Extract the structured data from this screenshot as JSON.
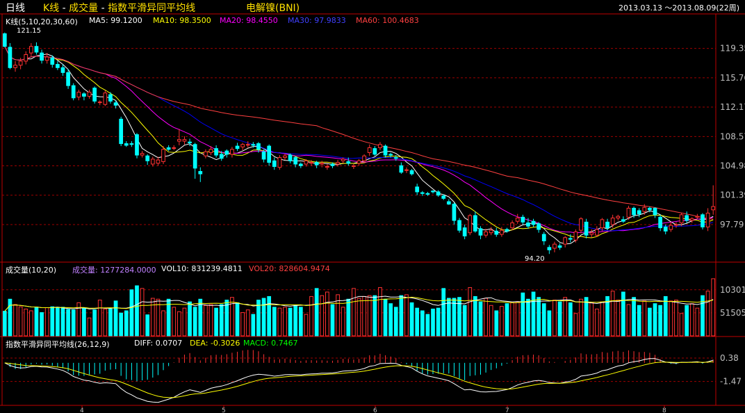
{
  "title_bar": {
    "period": "日线",
    "chart_type": "K线",
    "indicator_vol": "成交量",
    "indicator_macd": "指数平滑异同平均线",
    "separator": " - ",
    "instrument": "电解镍(BNI)",
    "date_range": "2013.03.13 ～2013.08.09(22周)"
  },
  "colors": {
    "up": "#ff3232",
    "down": "#00ffff",
    "ma5": "#ffffff",
    "ma10": "#ffff00",
    "ma20": "#ff00ff",
    "ma30": "#0000ff",
    "ma60": "#ff4040",
    "grid": "#a00000",
    "border": "#c00000",
    "label": "#c0c0c0"
  },
  "price_panel": {
    "header": "K线(5,10,20,30,60)",
    "ma_labels": [
      {
        "text": "MA5: 99.1200",
        "color": "#ffffff"
      },
      {
        "text": "MA10: 98.3500",
        "color": "#ffff00"
      },
      {
        "text": "MA20: 98.4550",
        "color": "#ff00ff"
      },
      {
        "text": "MA30: 97.9833",
        "color": "#4040ff"
      },
      {
        "text": "MA60: 100.4683",
        "color": "#ff4040"
      }
    ],
    "y_ticks": [
      "119.35",
      "115.76",
      "112.17",
      "108.57",
      "104.98",
      "101.39",
      "97.79"
    ],
    "high_label": "121.15",
    "low_label": "94.20"
  },
  "volume_panel": {
    "header": "成交量(10,20)",
    "vol_labels": [
      {
        "text": "成交量: 1277284.0000",
        "color": "#c080ff"
      },
      {
        "text": "VOL10: 831239.4811",
        "color": "#ffffff"
      },
      {
        "text": "VOL20: 828604.9474",
        "color": "#ff4040"
      }
    ],
    "y_ticks": [
      "10301",
      "51505"
    ]
  },
  "macd_panel": {
    "header": "指数平滑异同平均线(26,12,9)",
    "labels": [
      {
        "text": "DIFF: 0.0707",
        "color": "#ffffff"
      },
      {
        "text": "DEA: -0.3026",
        "color": "#ffff00"
      },
      {
        "text": "MACD: 0.7467",
        "color": "#00ff00"
      }
    ],
    "y_ticks": [
      "0.38",
      "-1.47"
    ]
  },
  "x_axis": {
    "month_labels": [
      "4",
      "5",
      "6",
      "7",
      "8"
    ]
  },
  "chart_data": {
    "type": "candlestick",
    "title": "K线 - 成交量 - 指数平滑异同平均线 电解镍(BNI)",
    "period": "daily",
    "date_range": [
      "2013.03.13",
      "2013.08.09"
    ],
    "price_ylim": [
      94.2,
      121.15
    ],
    "price_ticks": [
      119.35,
      115.76,
      112.17,
      108.57,
      104.98,
      101.39,
      97.79
    ],
    "candles": [
      [
        121.15,
        119.6,
        119.5,
        121.3
      ],
      [
        119.5,
        117.0,
        116.8,
        120.0
      ],
      [
        117.0,
        117.3,
        116.5,
        117.8
      ],
      [
        117.3,
        117.8,
        116.8,
        118.2
      ],
      [
        117.8,
        118.6,
        117.4,
        119.0
      ],
      [
        118.8,
        119.6,
        118.4,
        120.0
      ],
      [
        119.6,
        118.9,
        118.6,
        120.1
      ],
      [
        118.8,
        117.9,
        117.5,
        119.2
      ],
      [
        117.9,
        118.3,
        117.5,
        118.8
      ],
      [
        118.2,
        117.4,
        117.0,
        118.5
      ],
      [
        117.4,
        117.0,
        116.7,
        117.8
      ],
      [
        117.0,
        116.4,
        116.0,
        117.4
      ],
      [
        116.4,
        114.8,
        114.4,
        116.8
      ],
      [
        114.8,
        113.3,
        113.0,
        115.1
      ],
      [
        113.4,
        114.0,
        113.0,
        114.3
      ],
      [
        113.8,
        113.5,
        113.0,
        114.0
      ],
      [
        113.5,
        114.0,
        113.2,
        114.3
      ],
      [
        114.5,
        112.9,
        112.6,
        114.7
      ],
      [
        112.8,
        112.8,
        112.4,
        113.0
      ],
      [
        112.5,
        113.9,
        112.3,
        114.2
      ],
      [
        113.7,
        112.9,
        112.6,
        114.0
      ],
      [
        112.7,
        112.4,
        112.0,
        113.0
      ],
      [
        110.7,
        107.7,
        107.4,
        111.0
      ],
      [
        107.7,
        107.5,
        107.3,
        108.0
      ],
      [
        107.7,
        107.6,
        107.3,
        108.0
      ],
      [
        108.8,
        106.3,
        105.9,
        109.0
      ],
      [
        106.3,
        106.5,
        106.0,
        106.8
      ],
      [
        106.2,
        105.6,
        105.1,
        106.4
      ],
      [
        105.2,
        105.8,
        104.9,
        106.1
      ],
      [
        105.3,
        105.7,
        105.0,
        106.1
      ],
      [
        105.5,
        107.0,
        105.2,
        107.4
      ],
      [
        107.2,
        107.0,
        106.8,
        107.5
      ],
      [
        107.2,
        107.2,
        106.9,
        107.5
      ],
      [
        108.0,
        108.2,
        107.5,
        109.5
      ],
      [
        108.0,
        108.2,
        107.6,
        108.6
      ],
      [
        107.9,
        107.8,
        107.4,
        108.3
      ],
      [
        107.6,
        104.7,
        103.4,
        107.8
      ],
      [
        104.3,
        104.0,
        103.0,
        104.8
      ],
      [
        106.2,
        106.7,
        105.9,
        107.0
      ],
      [
        106.6,
        107.0,
        106.3,
        107.4
      ],
      [
        107.1,
        106.3,
        106.0,
        107.5
      ],
      [
        106.4,
        105.9,
        105.6,
        106.8
      ],
      [
        106.8,
        106.4,
        106.0,
        107.0
      ],
      [
        106.4,
        107.0,
        106.0,
        107.3
      ],
      [
        107.4,
        107.1,
        106.8,
        107.8
      ],
      [
        107.3,
        107.6,
        106.9,
        107.8
      ],
      [
        107.6,
        107.6,
        107.2,
        108.0
      ],
      [
        107.6,
        107.5,
        107.2,
        107.9
      ],
      [
        107.7,
        107.0,
        106.6,
        107.9
      ],
      [
        106.7,
        105.8,
        105.4,
        107.0
      ],
      [
        107.4,
        105.4,
        105.0,
        107.6
      ],
      [
        105.6,
        104.9,
        104.5,
        106.0
      ],
      [
        104.8,
        106.0,
        104.5,
        106.3
      ],
      [
        106.0,
        106.2,
        105.7,
        106.5
      ],
      [
        106.3,
        105.6,
        105.3,
        106.5
      ],
      [
        106.0,
        105.2,
        104.8,
        106.2
      ],
      [
        105.2,
        105.0,
        104.7,
        105.4
      ],
      [
        105.2,
        105.6,
        104.9,
        105.8
      ],
      [
        105.3,
        105.4,
        105.0,
        105.7
      ],
      [
        105.4,
        105.1,
        104.7,
        105.6
      ],
      [
        105.2,
        105.3,
        104.8,
        105.6
      ],
      [
        104.8,
        104.9,
        104.5,
        105.2
      ],
      [
        105.2,
        105.0,
        104.7,
        105.4
      ],
      [
        105.2,
        105.4,
        104.9,
        105.7
      ],
      [
        105.6,
        105.8,
        105.3,
        106.0
      ],
      [
        105.5,
        105.3,
        105.0,
        106.0
      ],
      [
        104.9,
        105.0,
        104.6,
        105.2
      ],
      [
        105.3,
        105.6,
        105.0,
        105.8
      ],
      [
        105.6,
        106.2,
        105.4,
        106.4
      ],
      [
        106.6,
        107.2,
        106.2,
        107.6
      ],
      [
        107.1,
        106.4,
        106.2,
        107.4
      ],
      [
        107.2,
        107.6,
        106.9,
        107.9
      ],
      [
        107.4,
        106.3,
        106.0,
        107.6
      ],
      [
        106.4,
        106.3,
        106.0,
        106.6
      ],
      [
        106.0,
        105.9,
        105.6,
        106.3
      ],
      [
        105.0,
        104.2,
        104.0,
        105.4
      ],
      [
        104.5,
        104.5,
        104.1,
        104.8
      ],
      [
        104.4,
        104.0,
        103.8,
        104.6
      ],
      [
        102.4,
        101.8,
        101.4,
        102.8
      ],
      [
        101.7,
        101.6,
        101.3,
        101.9
      ],
      [
        101.6,
        101.5,
        101.3,
        101.8
      ],
      [
        101.9,
        101.8,
        101.6,
        102.0
      ],
      [
        101.8,
        101.4,
        101.2,
        102.0
      ],
      [
        101.3,
        101.0,
        100.8,
        101.5
      ],
      [
        100.6,
        100.3,
        100.2,
        100.9
      ],
      [
        100.3,
        98.3,
        97.8,
        100.5
      ],
      [
        98.3,
        97.1,
        96.8,
        98.6
      ],
      [
        97.4,
        96.4,
        96.0,
        97.8
      ],
      [
        96.8,
        98.9,
        96.5,
        99.1
      ],
      [
        98.9,
        97.0,
        96.8,
        99.4
      ],
      [
        97.3,
        96.5,
        96.0,
        97.6
      ],
      [
        96.5,
        96.9,
        96.2,
        97.3
      ],
      [
        96.8,
        97.1,
        96.5,
        97.5
      ],
      [
        97.0,
        96.6,
        96.3,
        97.4
      ],
      [
        96.6,
        97.1,
        96.3,
        97.5
      ],
      [
        97.2,
        97.0,
        96.8,
        97.4
      ],
      [
        97.4,
        98.0,
        97.1,
        98.3
      ],
      [
        98.2,
        98.6,
        97.9,
        99.1
      ],
      [
        98.7,
        98.1,
        97.8,
        99.0
      ],
      [
        98.0,
        97.6,
        97.3,
        98.6
      ],
      [
        98.2,
        97.8,
        97.5,
        98.5
      ],
      [
        97.9,
        97.2,
        96.8,
        98.1
      ],
      [
        96.6,
        95.8,
        95.3,
        96.9
      ],
      [
        95.0,
        94.7,
        94.2,
        95.3
      ],
      [
        94.9,
        95.4,
        94.4,
        95.7
      ],
      [
        95.2,
        95.0,
        94.7,
        95.5
      ],
      [
        95.4,
        96.2,
        95.0,
        96.4
      ],
      [
        96.1,
        96.0,
        95.6,
        96.6
      ],
      [
        95.9,
        96.9,
        95.6,
        97.2
      ],
      [
        97.1,
        98.5,
        96.7,
        98.7
      ],
      [
        98.1,
        96.5,
        96.1,
        98.5
      ],
      [
        96.6,
        96.8,
        96.2,
        97.2
      ],
      [
        96.5,
        97.2,
        96.3,
        97.6
      ],
      [
        97.4,
        98.4,
        97.0,
        98.6
      ],
      [
        98.1,
        97.4,
        97.1,
        98.5
      ],
      [
        97.8,
        98.6,
        97.4,
        99.0
      ],
      [
        98.6,
        98.8,
        98.3,
        99.0
      ],
      [
        98.4,
        98.2,
        98.0,
        98.8
      ],
      [
        98.7,
        99.8,
        98.4,
        100.1
      ],
      [
        99.8,
        99.0,
        98.6,
        100.0
      ],
      [
        99.5,
        99.1,
        98.7,
        99.8
      ],
      [
        99.4,
        99.9,
        99.0,
        100.3
      ],
      [
        99.8,
        99.6,
        99.3,
        100.0
      ],
      [
        99.8,
        99.0,
        98.6,
        99.9
      ],
      [
        98.7,
        97.4,
        97.0,
        99.0
      ],
      [
        97.5,
        97.0,
        96.6,
        97.8
      ],
      [
        97.2,
        97.7,
        96.9,
        98.1
      ],
      [
        97.8,
        97.8,
        97.4,
        98.1
      ],
      [
        98.0,
        99.0,
        97.6,
        99.2
      ],
      [
        98.9,
        98.3,
        98.0,
        99.4
      ],
      [
        98.3,
        98.5,
        98.0,
        98.7
      ],
      [
        98.7,
        98.8,
        98.5,
        99.1
      ],
      [
        99.0,
        97.5,
        97.2,
        99.2
      ],
      [
        97.5,
        99.2,
        97.0,
        99.8
      ],
      [
        99.6,
        100.0,
        99.0,
        102.6
      ]
    ],
    "ma_series": [
      {
        "name": "MA5",
        "period": 5,
        "last": 99.12
      },
      {
        "name": "MA10",
        "period": 10,
        "last": 98.35
      },
      {
        "name": "MA20",
        "period": 20,
        "last": 98.455
      },
      {
        "name": "MA30",
        "period": 30,
        "last": 97.9833
      },
      {
        "name": "MA60",
        "period": 60,
        "last": 100.4683
      }
    ],
    "volume": {
      "ylim": [
        0,
        1400000
      ],
      "values": [
        550000,
        820000,
        700000,
        650000,
        600000,
        560000,
        640000,
        520000,
        630000,
        650000,
        640000,
        640000,
        590000,
        580000,
        740000,
        620000,
        400000,
        580000,
        800000,
        600000,
        600000,
        780000,
        510000,
        560000,
        1030000,
        1120000,
        1060000,
        470000,
        840000,
        820000,
        560000,
        820000,
        640000,
        540000,
        620000,
        760000,
        640000,
        820000,
        680000,
        700000,
        620000,
        700000,
        800000,
        860000,
        740000,
        520000,
        580000,
        480000,
        800000,
        840000,
        880000,
        640000,
        620000,
        640000,
        620000,
        680000,
        640000,
        480000,
        880000,
        1060000,
        900000,
        980000,
        700000,
        920000,
        640000,
        820000,
        1060000,
        840000,
        880000,
        900000,
        900000,
        1080000,
        820000,
        720000,
        640000,
        900000,
        920000,
        740000,
        620000,
        560000,
        480000,
        600000,
        620000,
        1060000,
        840000,
        840000,
        860000,
        680000,
        1080000,
        880000,
        760000,
        840000,
        680000,
        560000,
        660000,
        720000,
        740000,
        760000,
        960000,
        820000,
        980000,
        860000,
        720000,
        560000,
        800000,
        760000,
        860000,
        740000,
        500000,
        820000,
        860000,
        740000,
        600000,
        760000,
        880000,
        1000000,
        800000,
        980000,
        700000,
        860000,
        680000,
        780000,
        620000,
        720000,
        680000,
        880000,
        780000,
        800000,
        500000,
        680000,
        720000,
        620000,
        900000,
        1000000,
        1277284
      ],
      "vol10_last": 831239.4811,
      "vol20_last": 828604.9474
    },
    "macd": {
      "params": [
        26,
        12,
        9
      ],
      "ylim": [
        -3.3,
        1.2
      ],
      "diff_last": 0.0707,
      "dea_last": -0.3026,
      "macd_last": 0.7467
    }
  }
}
